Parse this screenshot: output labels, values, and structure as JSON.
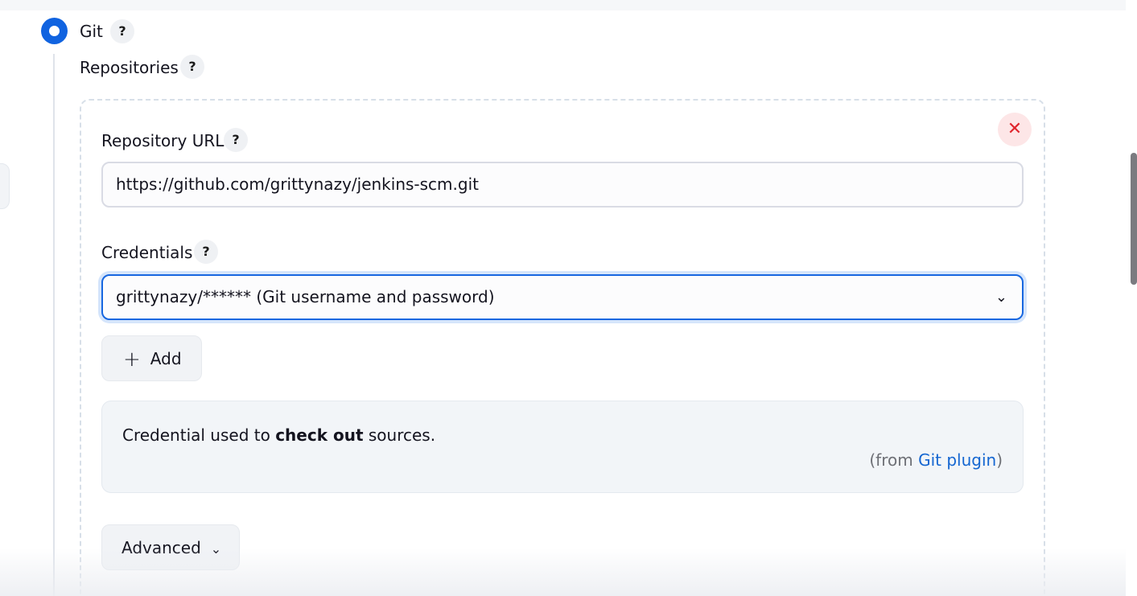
{
  "scm": {
    "option_label": "Git",
    "repositories_label": "Repositories"
  },
  "help_mark": "?",
  "repository": {
    "url_label": "Repository URL",
    "url_value": "https://github.com/grittynazy/jenkins-scm.git",
    "credentials_label": "Credentials",
    "credentials_value": "grittynazy/****** (Git username and password)",
    "add_label": "Add",
    "help_pre": "Credential used to ",
    "help_bold": "check out",
    "help_post": " sources.",
    "from_pre": "(from ",
    "from_link": "Git plugin",
    "from_post": ")",
    "advanced_label": "Advanced"
  },
  "icons": {
    "close": "close-icon",
    "plus": "plus-icon",
    "chevron": "chevron-down-icon"
  },
  "colors": {
    "accent": "#1063e0",
    "danger": "#e0252d",
    "link": "#1466d1"
  }
}
